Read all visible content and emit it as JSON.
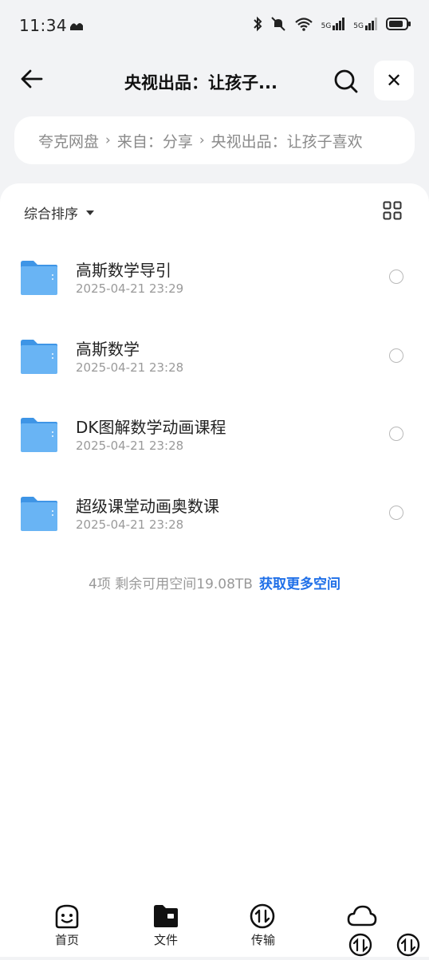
{
  "status_bar": {
    "time": "11:34",
    "network": [
      "5G",
      "5G"
    ]
  },
  "header": {
    "title": "央视出品：让孩子...",
    "back_icon": "arrow-left-icon",
    "search_icon": "search-icon",
    "close_label": "✕"
  },
  "breadcrumb": {
    "items": [
      "夸克网盘",
      "来自：分享",
      "央视出品：让孩子喜欢"
    ],
    "separator": "›"
  },
  "toolbar": {
    "sort_label": "综合排序"
  },
  "files": [
    {
      "name": "高斯数学导引",
      "date": "2025-04-21 23:29"
    },
    {
      "name": "高斯数学",
      "date": "2025-04-21 23:28"
    },
    {
      "name": "DK图解数学动画课程",
      "date": "2025-04-21 23:28"
    },
    {
      "name": "超级课堂动画奥数课",
      "date": "2025-04-21 23:28"
    }
  ],
  "summary": {
    "text": "4项 剩余可用空间19.08TB",
    "link": "获取更多空间"
  },
  "bottom_nav": [
    {
      "label": "首页",
      "icon": "home-face-icon"
    },
    {
      "label": "文件",
      "icon": "folder-icon"
    },
    {
      "label": "传输",
      "icon": "transfer-icon"
    },
    {
      "label": "",
      "icon": "cloud-icon"
    }
  ],
  "colors": {
    "accent": "#1f6fe8",
    "folder": "#5aa9f0",
    "background": "#f2f3f5"
  }
}
